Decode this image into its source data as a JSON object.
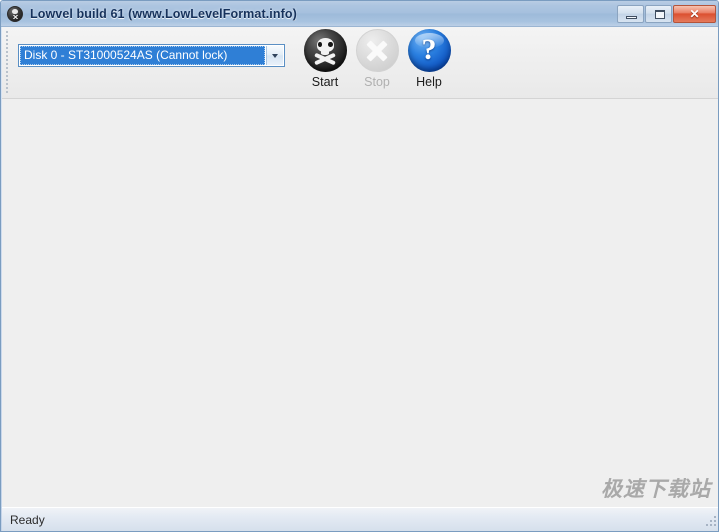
{
  "window": {
    "title": "Lowvel build 61 (www.LowLevelFormat.info)",
    "app_icon": "skull-app-icon",
    "controls": {
      "minimize": "minimize-icon",
      "maximize": "maximize-icon",
      "close_glyph": "✕"
    },
    "colors": {
      "titlebar_text": "#16325c",
      "titlebar_gradient_top": "#b9cde4",
      "titlebar_gradient_bottom": "#bcd0e6",
      "close_button": "#db5030",
      "client_background": "#efefef",
      "combo_selection": "#2f7fd6",
      "help_blue": "#0b4fbe"
    }
  },
  "toolbar": {
    "gripper": "toolbar-gripper",
    "disk_combo": {
      "selected_value": "Disk 0 - ST31000524AS (Cannot lock)",
      "arrow_icon": "chevron-down-icon"
    },
    "buttons": [
      {
        "label": "Start",
        "icon": "skull-icon",
        "enabled": true
      },
      {
        "label": "Stop",
        "icon": "x-circle-icon",
        "enabled": false
      },
      {
        "label": "Help",
        "icon": "question-mark-icon",
        "enabled": true
      }
    ]
  },
  "client": {
    "watermark": "极速下载站"
  },
  "status_bar": {
    "text": "Ready",
    "resize_grip": "resize-grip-icon"
  }
}
